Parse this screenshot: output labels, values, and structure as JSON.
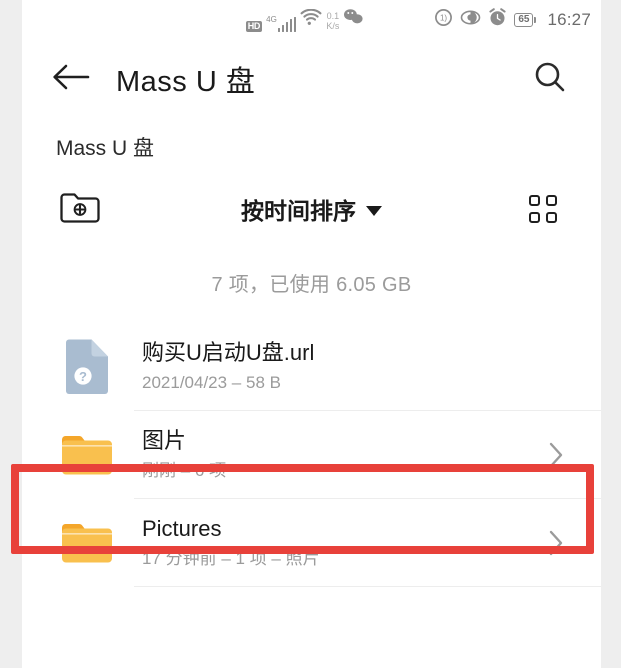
{
  "status_bar": {
    "hd_label": "HD",
    "network_label": "4G",
    "speed_value": "0.1",
    "speed_unit": "K/s",
    "icons": [
      "hd-badge",
      "signal-bars-icon",
      "wifi-icon",
      "network-speed",
      "wechat-icon",
      "vibrate-icon",
      "eye-comfort-icon",
      "alarm-clock-icon",
      "battery-icon"
    ],
    "battery_level": "65",
    "time": "16:27"
  },
  "appbar": {
    "back_icon": "arrow-left-icon",
    "title": "Mass U 盘",
    "search_icon": "search-icon"
  },
  "breadcrumb": {
    "path": "Mass U 盘"
  },
  "toolbar": {
    "new_folder_icon": "folder-plus-icon",
    "sort_label": "按时间排序",
    "sort_caret_icon": "chevron-down-icon",
    "view_toggle_icon": "grid-view-icon"
  },
  "summary": {
    "text": "7 项，已使用 6.05 GB"
  },
  "list": {
    "items": [
      {
        "icon": "unknown-file-icon",
        "icon_type": "document",
        "title": "购买U启动U盘.url",
        "subtitle": "2021/04/23 – 58 B",
        "has_chevron": false,
        "highlighted": false
      },
      {
        "icon": "folder-icon",
        "icon_type": "folder",
        "title": "图片",
        "subtitle": "刚刚 – 6 项",
        "has_chevron": true,
        "highlighted": true
      },
      {
        "icon": "folder-icon",
        "icon_type": "folder",
        "title": "Pictures",
        "subtitle": "17 分钟前 – 1 项 – 照片",
        "has_chevron": true,
        "highlighted": false
      }
    ]
  },
  "colors": {
    "folder": "#f9c04e",
    "folder_tab": "#f4a62a",
    "document": "#a9bcd0",
    "annotation_red": "#e8413a",
    "text_primary": "#1a1a1a",
    "text_secondary": "#9b9b9b",
    "page_background": "#eeeeee"
  }
}
